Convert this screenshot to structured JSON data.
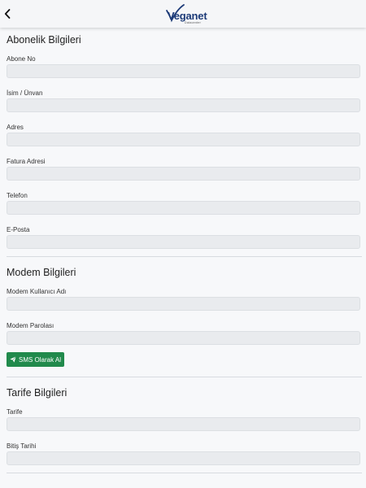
{
  "header": {
    "logo_text": "Veganet",
    "logo_subtext": "Datacenter",
    "back_icon": "chevron-left-icon"
  },
  "subscription": {
    "title": "Abonelik Bilgileri",
    "fields": [
      {
        "label": "Abone No",
        "value": ""
      },
      {
        "label": "İsim / Ünvan",
        "value": ""
      },
      {
        "label": "Adres",
        "value": ""
      },
      {
        "label": "Fatura Adresi",
        "value": ""
      },
      {
        "label": "Telefon",
        "value": ""
      },
      {
        "label": "E-Posta",
        "value": ""
      }
    ]
  },
  "modem": {
    "title": "Modem Bilgileri",
    "fields": [
      {
        "label": "Modem Kullanıcı Adı",
        "value": ""
      },
      {
        "label": "Modem Parolası",
        "value": ""
      }
    ],
    "sms_button_label": "SMS Olarak Al",
    "sms_button_icon": "paper-plane-icon",
    "sms_button_color": "#218a4c"
  },
  "tariff": {
    "title": "Tarife Bilgileri",
    "fields": [
      {
        "label": "Tarife",
        "value": ""
      },
      {
        "label": "Bitiş Tarihi",
        "value": ""
      }
    ]
  }
}
